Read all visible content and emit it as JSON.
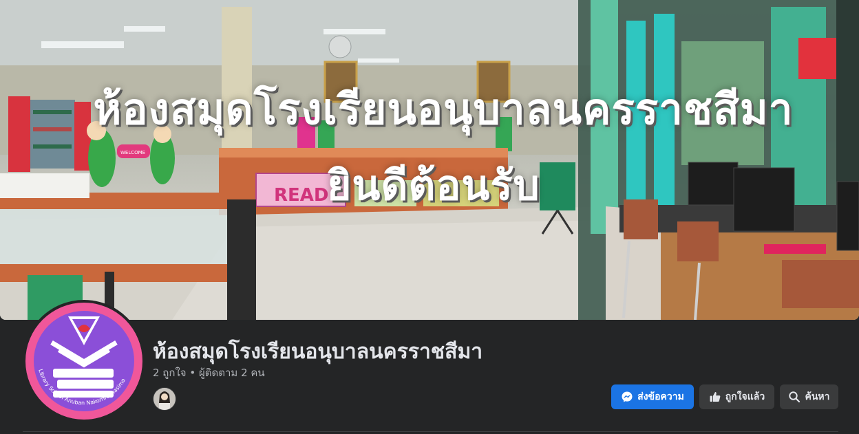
{
  "cover": {
    "headline_line1": "ห้องสมุดโรงเรียนอนุบาลนครราชสีมา",
    "headline_line2": "ยินดีต้อนรับ",
    "scene_text": {
      "read_sign": "READ",
      "welcome_sign": "WELCOME"
    }
  },
  "profile": {
    "logo_text": "Library School Anuban Nakornrachasima",
    "page_name": "ห้องสมุดโรงเรียนอนุบาลนครราชสีมา",
    "stats": "2 ถูกใจ • ผู้ติดตาม 2 คน"
  },
  "actions": {
    "message_label": "ส่งข้อความ",
    "liked_label": "ถูกใจแล้ว",
    "search_label": "ค้นหา"
  },
  "icons": {
    "message": "messenger-icon",
    "liked": "thumbs-up-icon",
    "search": "search-icon"
  },
  "colors": {
    "background": "#242526",
    "primary_button": "#1b74e4",
    "secondary_button": "#3a3b3c",
    "logo_pink": "#f0579a",
    "logo_purple": "#8b4fd8"
  }
}
